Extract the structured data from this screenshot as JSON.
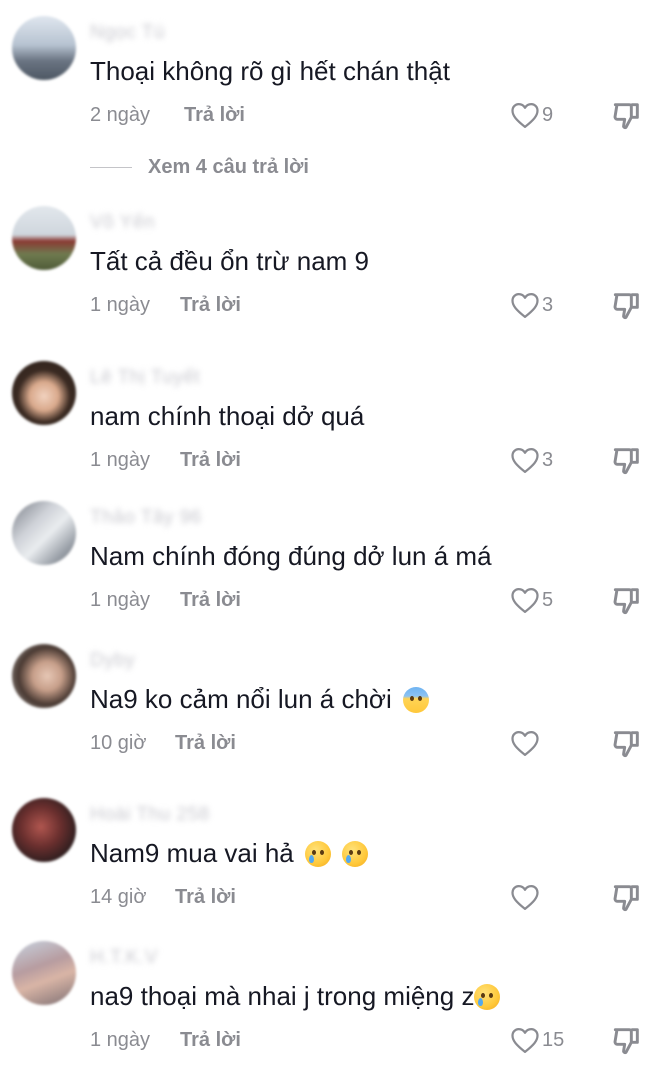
{
  "reply_label": "Trả lời",
  "view_replies_label": "Xem 4 câu trả lời",
  "colors": {
    "text": "#161823",
    "muted": "#8a8b91",
    "username": "#c9c9cf"
  },
  "comments": [
    {
      "username": "Ngọc Tú",
      "text": "Thoại không rõ gì hết chán thật",
      "emojis": [],
      "time": "2 ngày",
      "likes": "9",
      "avatar": "avatar-landscape"
    },
    {
      "username": "Võ Yến",
      "text": "Tất cả đều ổn trừ nam 9",
      "emojis": [],
      "time": "1 ngày",
      "likes": "3",
      "avatar": "avatar-person-field"
    },
    {
      "username": "Lê Thị Tuyết",
      "text": "nam chính thoại dở quá",
      "emojis": [],
      "time": "1 ngày",
      "likes": "3",
      "avatar": "avatar-portrait"
    },
    {
      "username": "Thảo Tây 96",
      "text": "Nam chính đóng đúng dở lun á má",
      "emojis": [],
      "time": "1 ngày",
      "likes": "5",
      "avatar": "avatar-photo"
    },
    {
      "username": "Dyby",
      "text": "Na9 ko cảm nổi lun á chời",
      "emojis": [
        "fearful-face-emoji"
      ],
      "time": "10 giờ",
      "likes": "",
      "avatar": "avatar-portrait-2"
    },
    {
      "username": "Hoài Thu 258",
      "text": "Nam9 mua vai hả",
      "emojis": [
        "crying-face-emoji",
        "crying-face-emoji"
      ],
      "time": "14 giờ",
      "likes": "",
      "avatar": "avatar-dark"
    },
    {
      "username": "H.T.K.V",
      "text": "na9 thoại mà nhai j trong miệng z",
      "emojis": [
        "crying-face-emoji"
      ],
      "time": "1 ngày",
      "likes": "15",
      "avatar": "avatar-person-2"
    }
  ]
}
